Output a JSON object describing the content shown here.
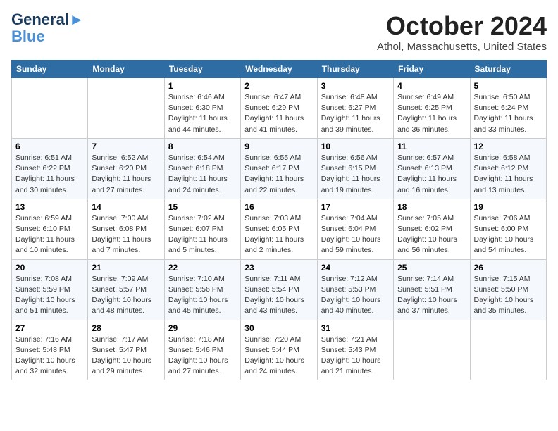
{
  "logo": {
    "line1": "General",
    "line2": "Blue"
  },
  "title": "October 2024",
  "location": "Athol, Massachusetts, United States",
  "headers": [
    "Sunday",
    "Monday",
    "Tuesday",
    "Wednesday",
    "Thursday",
    "Friday",
    "Saturday"
  ],
  "weeks": [
    [
      {
        "day": "",
        "info": ""
      },
      {
        "day": "",
        "info": ""
      },
      {
        "day": "1",
        "info": "Sunrise: 6:46 AM\nSunset: 6:30 PM\nDaylight: 11 hours and 44 minutes."
      },
      {
        "day": "2",
        "info": "Sunrise: 6:47 AM\nSunset: 6:29 PM\nDaylight: 11 hours and 41 minutes."
      },
      {
        "day": "3",
        "info": "Sunrise: 6:48 AM\nSunset: 6:27 PM\nDaylight: 11 hours and 39 minutes."
      },
      {
        "day": "4",
        "info": "Sunrise: 6:49 AM\nSunset: 6:25 PM\nDaylight: 11 hours and 36 minutes."
      },
      {
        "day": "5",
        "info": "Sunrise: 6:50 AM\nSunset: 6:24 PM\nDaylight: 11 hours and 33 minutes."
      }
    ],
    [
      {
        "day": "6",
        "info": "Sunrise: 6:51 AM\nSunset: 6:22 PM\nDaylight: 11 hours and 30 minutes."
      },
      {
        "day": "7",
        "info": "Sunrise: 6:52 AM\nSunset: 6:20 PM\nDaylight: 11 hours and 27 minutes."
      },
      {
        "day": "8",
        "info": "Sunrise: 6:54 AM\nSunset: 6:18 PM\nDaylight: 11 hours and 24 minutes."
      },
      {
        "day": "9",
        "info": "Sunrise: 6:55 AM\nSunset: 6:17 PM\nDaylight: 11 hours and 22 minutes."
      },
      {
        "day": "10",
        "info": "Sunrise: 6:56 AM\nSunset: 6:15 PM\nDaylight: 11 hours and 19 minutes."
      },
      {
        "day": "11",
        "info": "Sunrise: 6:57 AM\nSunset: 6:13 PM\nDaylight: 11 hours and 16 minutes."
      },
      {
        "day": "12",
        "info": "Sunrise: 6:58 AM\nSunset: 6:12 PM\nDaylight: 11 hours and 13 minutes."
      }
    ],
    [
      {
        "day": "13",
        "info": "Sunrise: 6:59 AM\nSunset: 6:10 PM\nDaylight: 11 hours and 10 minutes."
      },
      {
        "day": "14",
        "info": "Sunrise: 7:00 AM\nSunset: 6:08 PM\nDaylight: 11 hours and 7 minutes."
      },
      {
        "day": "15",
        "info": "Sunrise: 7:02 AM\nSunset: 6:07 PM\nDaylight: 11 hours and 5 minutes."
      },
      {
        "day": "16",
        "info": "Sunrise: 7:03 AM\nSunset: 6:05 PM\nDaylight: 11 hours and 2 minutes."
      },
      {
        "day": "17",
        "info": "Sunrise: 7:04 AM\nSunset: 6:04 PM\nDaylight: 10 hours and 59 minutes."
      },
      {
        "day": "18",
        "info": "Sunrise: 7:05 AM\nSunset: 6:02 PM\nDaylight: 10 hours and 56 minutes."
      },
      {
        "day": "19",
        "info": "Sunrise: 7:06 AM\nSunset: 6:00 PM\nDaylight: 10 hours and 54 minutes."
      }
    ],
    [
      {
        "day": "20",
        "info": "Sunrise: 7:08 AM\nSunset: 5:59 PM\nDaylight: 10 hours and 51 minutes."
      },
      {
        "day": "21",
        "info": "Sunrise: 7:09 AM\nSunset: 5:57 PM\nDaylight: 10 hours and 48 minutes."
      },
      {
        "day": "22",
        "info": "Sunrise: 7:10 AM\nSunset: 5:56 PM\nDaylight: 10 hours and 45 minutes."
      },
      {
        "day": "23",
        "info": "Sunrise: 7:11 AM\nSunset: 5:54 PM\nDaylight: 10 hours and 43 minutes."
      },
      {
        "day": "24",
        "info": "Sunrise: 7:12 AM\nSunset: 5:53 PM\nDaylight: 10 hours and 40 minutes."
      },
      {
        "day": "25",
        "info": "Sunrise: 7:14 AM\nSunset: 5:51 PM\nDaylight: 10 hours and 37 minutes."
      },
      {
        "day": "26",
        "info": "Sunrise: 7:15 AM\nSunset: 5:50 PM\nDaylight: 10 hours and 35 minutes."
      }
    ],
    [
      {
        "day": "27",
        "info": "Sunrise: 7:16 AM\nSunset: 5:48 PM\nDaylight: 10 hours and 32 minutes."
      },
      {
        "day": "28",
        "info": "Sunrise: 7:17 AM\nSunset: 5:47 PM\nDaylight: 10 hours and 29 minutes."
      },
      {
        "day": "29",
        "info": "Sunrise: 7:18 AM\nSunset: 5:46 PM\nDaylight: 10 hours and 27 minutes."
      },
      {
        "day": "30",
        "info": "Sunrise: 7:20 AM\nSunset: 5:44 PM\nDaylight: 10 hours and 24 minutes."
      },
      {
        "day": "31",
        "info": "Sunrise: 7:21 AM\nSunset: 5:43 PM\nDaylight: 10 hours and 21 minutes."
      },
      {
        "day": "",
        "info": ""
      },
      {
        "day": "",
        "info": ""
      }
    ]
  ]
}
